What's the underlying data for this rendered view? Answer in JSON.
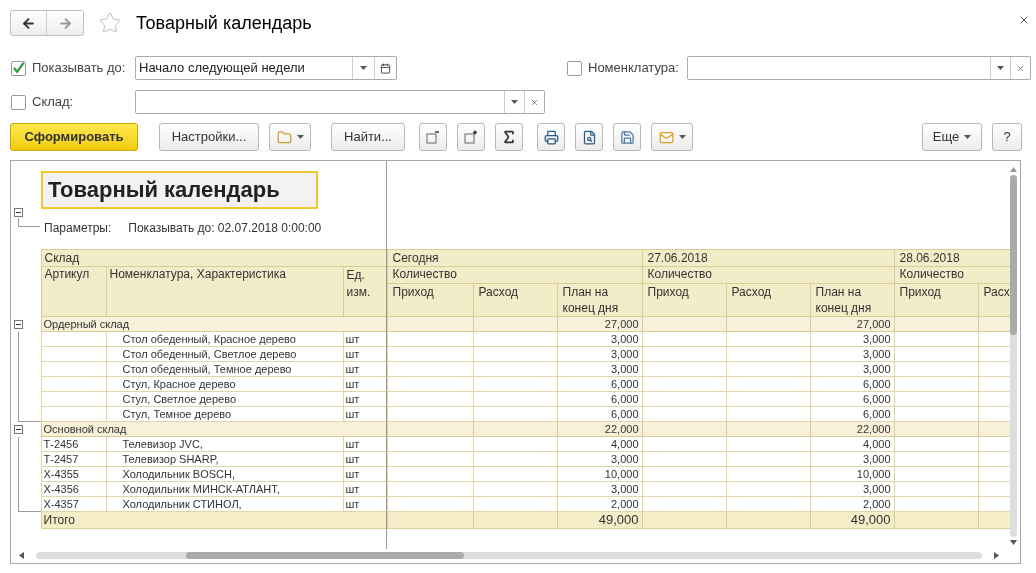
{
  "window": {
    "title": "Товарный календарь"
  },
  "filters": {
    "show_until": {
      "label": "Показывать до:",
      "checked": true,
      "value": "Начало следующей недели"
    },
    "nomenclature": {
      "label": "Номенклатура:",
      "checked": false
    },
    "warehouse": {
      "label": "Склад:",
      "checked": false
    }
  },
  "toolbar": {
    "generate": "Сформировать",
    "settings": "Настройки...",
    "find": "Найти...",
    "more": "Еще",
    "help": "?"
  },
  "report": {
    "title": "Товарный календарь",
    "expanded": true,
    "parameters_label": "Параметры:",
    "parameters_value": "Показывать до: 02.07.2018 0:00:00",
    "header": {
      "group_label": "Склад",
      "article": "Артикул",
      "item": "Номенклатура, Характеристика",
      "unit": "Ед. изм.",
      "days": [
        {
          "label": "Сегодня",
          "measure": "Количество",
          "subcolumns": [
            "Приход",
            "Расход",
            "План на конец дня"
          ]
        },
        {
          "label": "27.06.2018",
          "measure": "Количество",
          "subcolumns": [
            "Приход",
            "Расход",
            "План на конец дня"
          ]
        },
        {
          "label": "28.06.2018",
          "measure": "Количество",
          "subcolumns": [
            "Приход",
            "Расх"
          ]
        }
      ]
    },
    "groups": [
      {
        "name": "Ордерный склад",
        "expanded": true,
        "plan": [
          "27,000",
          "27,000"
        ],
        "rows": [
          {
            "item": "Стол обеденный, Красное дерево",
            "unit": "шт",
            "plan": [
              "3,000",
              "3,000"
            ]
          },
          {
            "item": "Стол обеденный, Светлое дерево",
            "unit": "шт",
            "plan": [
              "3,000",
              "3,000"
            ]
          },
          {
            "item": "Стол обеденный, Темное дерево",
            "unit": "шт",
            "plan": [
              "3,000",
              "3,000"
            ]
          },
          {
            "item": "Стул, Красное дерево",
            "unit": "шт",
            "plan": [
              "6,000",
              "6,000"
            ]
          },
          {
            "item": "Стул, Светлое дерево",
            "unit": "шт",
            "plan": [
              "6,000",
              "6,000"
            ]
          },
          {
            "item": "Стул, Темное дерево",
            "unit": "шт",
            "plan": [
              "6,000",
              "6,000"
            ]
          }
        ]
      },
      {
        "name": "Основной склад",
        "expanded": true,
        "plan": [
          "22,000",
          "22,000"
        ],
        "rows": [
          {
            "article": "Т-2456",
            "item": "Телевизор JVC,",
            "unit": "шт",
            "plan": [
              "4,000",
              "4,000"
            ]
          },
          {
            "article": "Т-2457",
            "item": "Телевизор SHARP,",
            "unit": "шт",
            "plan": [
              "3,000",
              "3,000"
            ]
          },
          {
            "article": "Х-4355",
            "item": "Холодильник BOSCH,",
            "unit": "шт",
            "plan": [
              "10,000",
              "10,000"
            ]
          },
          {
            "article": "Х-4356",
            "item": "Холодильник МИНСК-АТЛАНТ,",
            "unit": "шт",
            "plan": [
              "3,000",
              "3,000"
            ]
          },
          {
            "article": "Х-4357",
            "item": "Холодильник СТИНОЛ,",
            "unit": "шт",
            "plan": [
              "2,000",
              "2,000"
            ]
          }
        ]
      }
    ],
    "total": {
      "label": "Итого",
      "plan": [
        "49,000",
        "49,000"
      ]
    }
  }
}
